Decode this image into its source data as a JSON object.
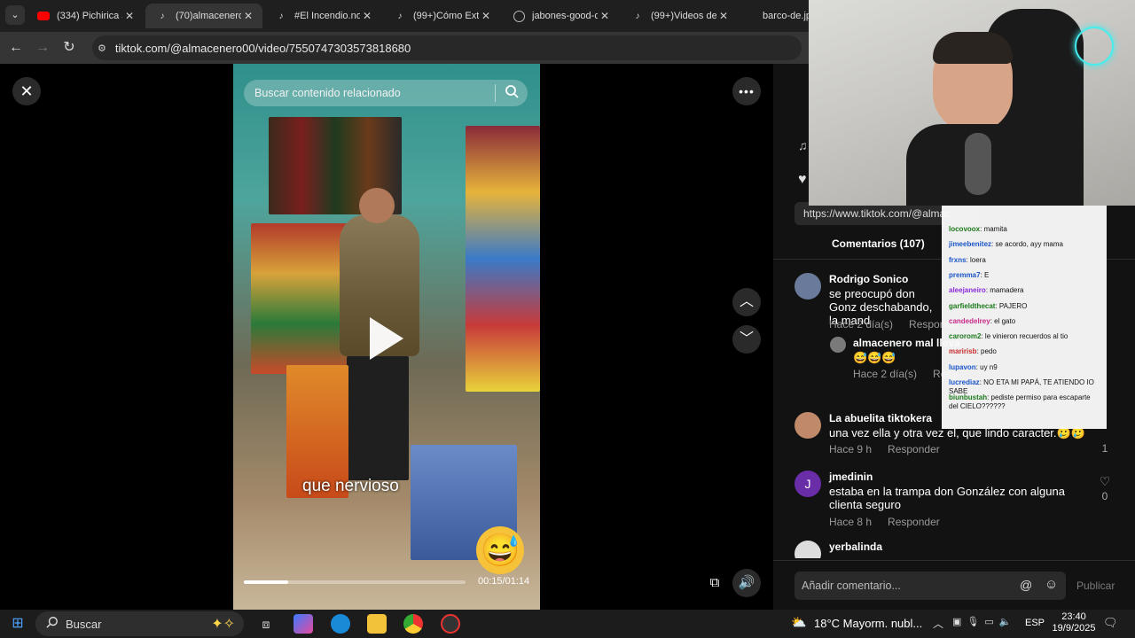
{
  "browser": {
    "tabs": [
      {
        "title": "(334) Pichirica Ja",
        "icon": "youtube-icon",
        "color": "#ff0000"
      },
      {
        "title": "(70)almacenero",
        "icon": "tiktok-icon",
        "color": "#ffffff"
      },
      {
        "title": "#El Incendio.no",
        "icon": "tiktok-icon",
        "color": "#ffffff"
      },
      {
        "title": "(99+)Cómo Extr",
        "icon": "tiktok-icon",
        "color": "#ffffff"
      },
      {
        "title": "jabones-good-c",
        "icon": "globe-icon",
        "color": "#bbbbbb"
      },
      {
        "title": "(99+)Videos de",
        "icon": "tiktok-icon",
        "color": "#ffffff"
      },
      {
        "title": "barco-de.jpg",
        "icon": "image-icon",
        "color": "#bbbbbb"
      }
    ],
    "url": "tiktok.com/@almacenero00/video/7550747303573818680"
  },
  "video": {
    "search_placeholder": "Buscar contenido relacionado",
    "caption": "que  nervioso",
    "time": "00:15/01:14",
    "progress": 0.2,
    "emoji": "😅"
  },
  "panel": {
    "share_url": "https://www.tiktok.com/@almac",
    "comments_tab": "Comentarios (107)",
    "comments": [
      {
        "name": "Rodrigo Sonico",
        "text": "se preocupó don Gonz deschabando, la mand",
        "date": "Hace 2 día(s)",
        "reply": "Responder",
        "likes": "",
        "avatar_color": "#6a7a9a"
      },
      {
        "name": "almacenero mal lleva",
        "text": "😅😅😅",
        "date": "Hace 2 día(s)",
        "reply": "Resp",
        "likes": "",
        "avatar_color": "#7a7a7a"
      },
      {
        "name": "La abuelita tiktokera",
        "text": "una vez ella y otra vez el, que lindo caracter.🥲🥲",
        "date": "Hace 9 h",
        "reply": "Responder",
        "likes": "1",
        "avatar_color": "#c08a6a"
      },
      {
        "name": "jmedinin",
        "text": "estaba en la trampa don González con alguna clienta seguro",
        "date": "Hace 8 h",
        "reply": "Responder",
        "likes": "0",
        "avatar_color": "#6a2da8",
        "initial": "J"
      },
      {
        "name": "yerbalinda",
        "text": "",
        "date": "",
        "reply": "",
        "likes": "",
        "avatar_color": "#dddddd"
      }
    ],
    "comment_placeholder": "Añadir comentario...",
    "publish_label": "Publicar"
  },
  "chat": [
    {
      "user": "locovoox",
      "msg": "mamita",
      "color": "#1a7a1a"
    },
    {
      "user": "jimeebenitez",
      "msg": "se acordo, ayy mama",
      "color": "#1a55c8"
    },
    {
      "user": "frxns",
      "msg": "loera",
      "color": "#1a55c8"
    },
    {
      "user": "premma7",
      "msg": "E",
      "color": "#1a55c8"
    },
    {
      "user": "aleejaneiro",
      "msg": "mamadera",
      "color": "#8a2ad8"
    },
    {
      "user": "garfieldthecat",
      "msg": "PAJERO",
      "color": "#1a7a1a"
    },
    {
      "user": "candedelrey",
      "msg": "el gato",
      "color": "#c82a8a"
    },
    {
      "user": "carorom2",
      "msg": "le vinieron recuerdos al tio",
      "color": "#1a7a1a"
    },
    {
      "user": "maririsb",
      "msg": "pedo",
      "color": "#c82a2a"
    },
    {
      "user": "lupavon",
      "msg": "uy n9",
      "color": "#1a55c8"
    },
    {
      "user": "lucrediaz",
      "msg": "NO ETA MI PAPÁ, TE ATIENDO IO SABE",
      "color": "#1a55c8"
    },
    {
      "user": "biunbustah",
      "msg": "pediste permiso para escaparte del CIELO??????",
      "color": "#1a7a1a"
    }
  ],
  "taskbar": {
    "search_label": "Buscar",
    "weather": "18°C  Mayorm. nubl...",
    "lang": "ESP",
    "time": "23:40",
    "date": "19/9/2025"
  }
}
